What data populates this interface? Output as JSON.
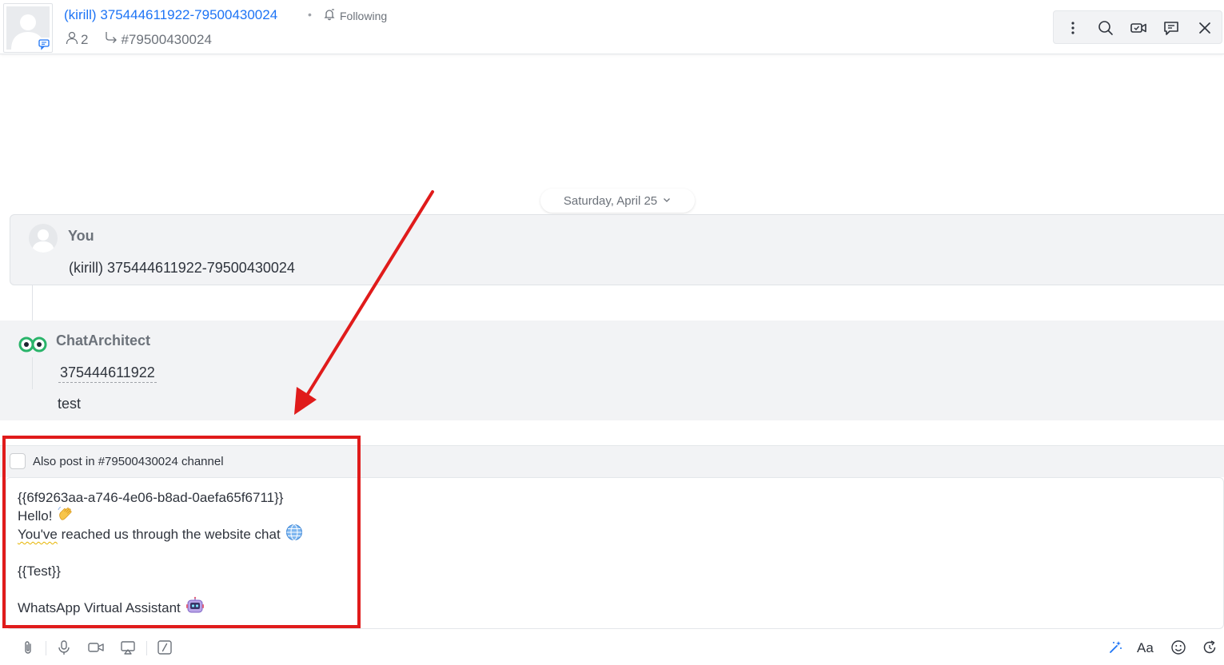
{
  "header": {
    "room_title": "(kirill) 375444611922-79500430024",
    "title_separator": "•",
    "follow_label": "Following",
    "member_count": "2",
    "parent_channel": "#79500430024"
  },
  "toolbar": {
    "icons": [
      "kebab-menu-icon",
      "search-icon",
      "video-call-icon",
      "threads-icon",
      "close-icon"
    ]
  },
  "date_divider": {
    "label": "Saturday, April 25"
  },
  "messages": [
    {
      "user": "You",
      "text": "(kirill) 375444611922-79500430024"
    },
    {
      "user": "ChatArchitect",
      "mention": "375444611922",
      "text": "test"
    }
  ],
  "composer": {
    "also_post_label": "Also post in #79500430024 channel",
    "also_post_checked": false,
    "lines": [
      "{{6f9263aa-a746-4e06-b8ad-0aefa65f6711}}",
      "Hello!",
      "You've reached us through the website chat",
      "",
      "{{Test}}",
      "",
      "WhatsApp Virtual Assistant"
    ],
    "left_tools": [
      "attachment-icon",
      "microphone-icon",
      "video-message-icon",
      "screen-share-icon",
      "slash-command-icon"
    ],
    "right_tools": [
      "magic-format-icon",
      "text-format-icon",
      "emoji-icon",
      "refresh-icon"
    ]
  },
  "colors": {
    "accent": "#1d74f5",
    "highlight_border": "#e01b1b",
    "bot_logo_green": "#2ab46a"
  }
}
